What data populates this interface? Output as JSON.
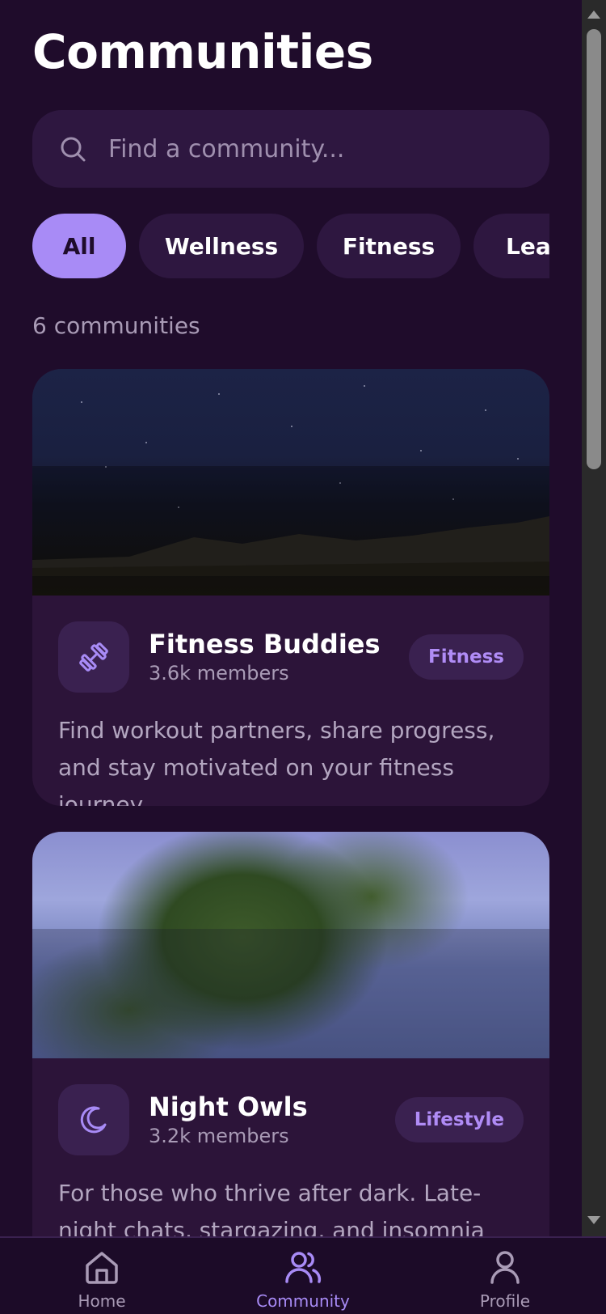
{
  "header": {
    "title": "Communities"
  },
  "search": {
    "placeholder": "Find a community..."
  },
  "filters": [
    {
      "label": "All",
      "active": true
    },
    {
      "label": "Wellness",
      "active": false
    },
    {
      "label": "Fitness",
      "active": false
    },
    {
      "label": "Lear",
      "active": false
    }
  ],
  "results": {
    "count_label": "6 communities"
  },
  "communities": [
    {
      "name": "Fitness Buddies",
      "members": "3.6k members",
      "tag": "Fitness",
      "icon": "dumbbell-icon",
      "description": "Find workout partners, share progress, and stay motivated on your fitness journey ..."
    },
    {
      "name": "Night Owls",
      "members": "3.2k members",
      "tag": "Lifestyle",
      "icon": "moon-icon",
      "description": "For those who thrive after dark. Late-night chats, stargazing, and insomnia support."
    }
  ],
  "bottom_nav": [
    {
      "label": "Home",
      "icon": "home-icon",
      "active": false
    },
    {
      "label": "Community",
      "icon": "community-icon",
      "active": true
    },
    {
      "label": "Profile",
      "icon": "profile-icon",
      "active": false
    }
  ],
  "colors": {
    "background": "#1f0c2b",
    "card": "#2c1439",
    "accent": "#a88bf6",
    "tag_text": "#b08cf6",
    "muted_text": "#a99bb6"
  }
}
